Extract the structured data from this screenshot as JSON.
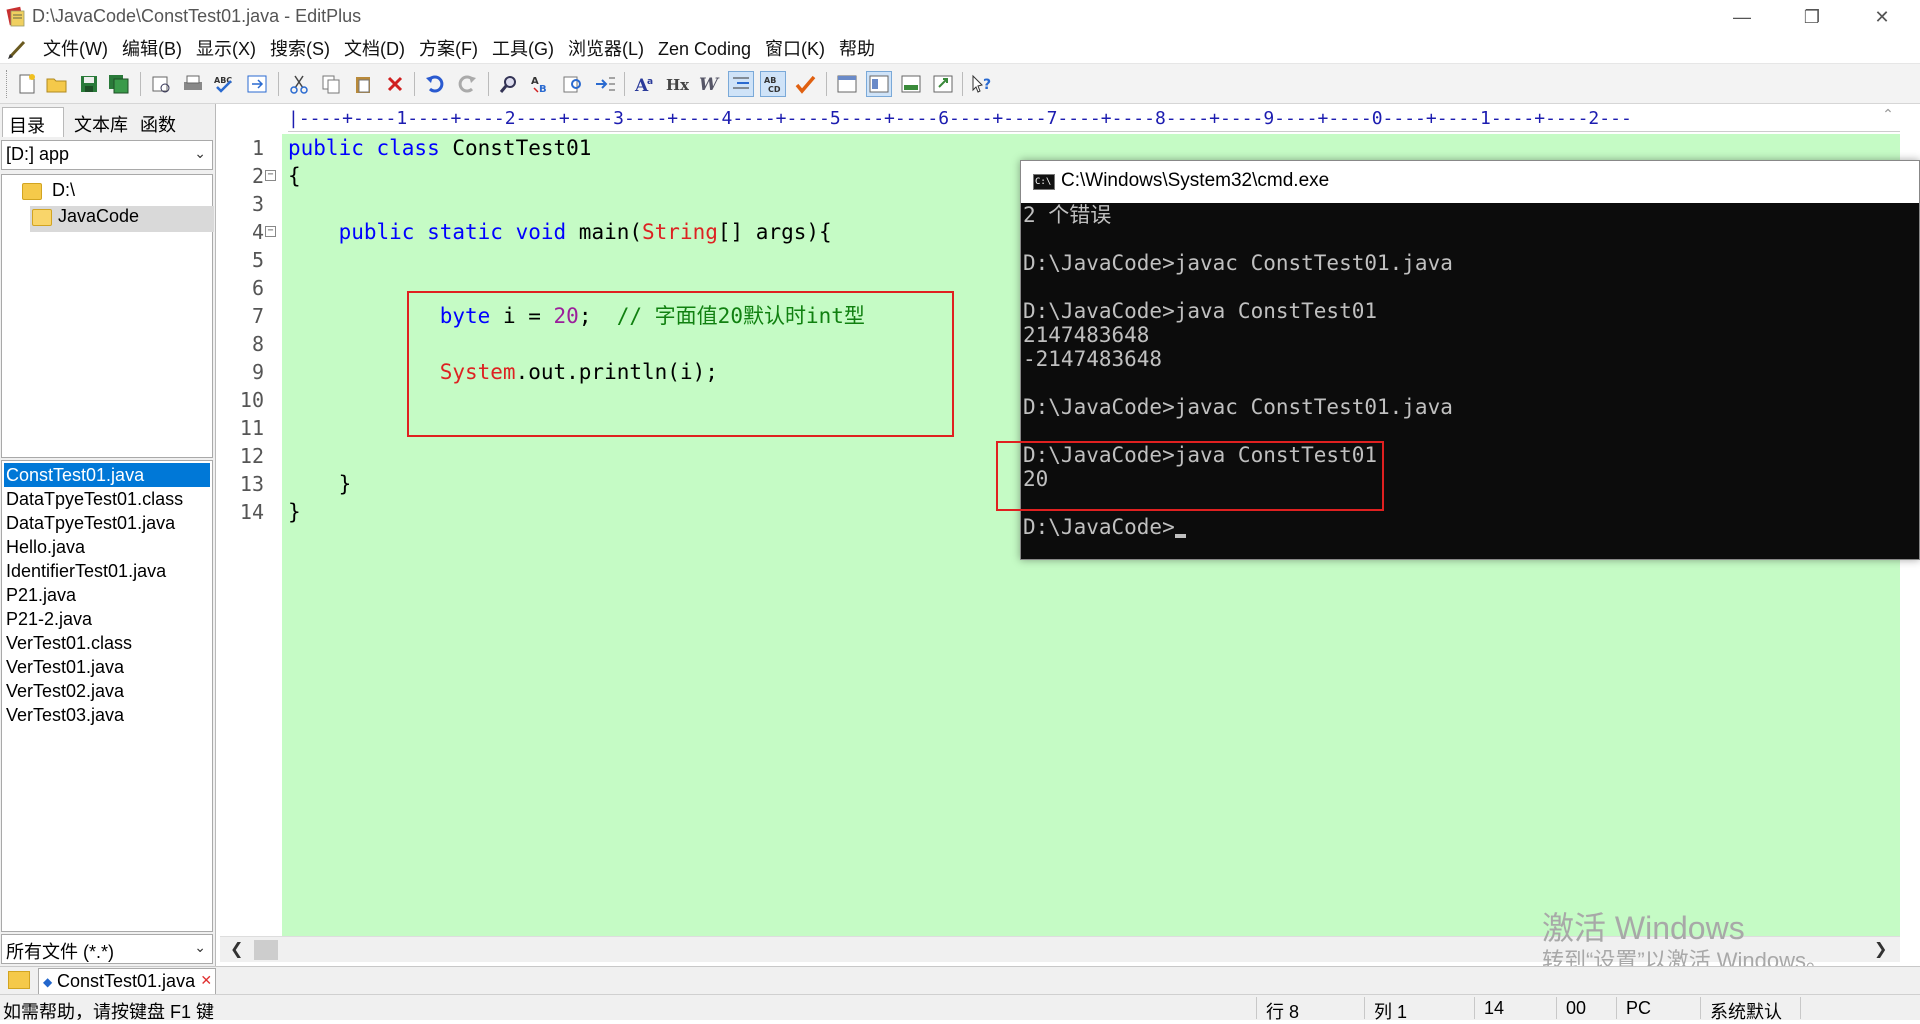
{
  "window": {
    "title": "D:\\JavaCode\\ConstTest01.java - EditPlus",
    "minimize": "—",
    "restore": "❐",
    "close": "✕"
  },
  "menu": [
    "文件(W)",
    "编辑(B)",
    "显示(X)",
    "搜索(S)",
    "文档(D)",
    "方案(F)",
    "工具(G)",
    "浏览器(L)",
    "Zen Coding",
    "窗口(K)",
    "帮助"
  ],
  "mdi_buttons": [
    "_",
    "▫",
    "x"
  ],
  "left_panel": {
    "tabs": [
      "目录",
      "文本库",
      "函数"
    ],
    "drive": "[D:] app",
    "tree": [
      "D:\\",
      "JavaCode"
    ],
    "files": [
      "ConstTest01.java",
      "DataTpyeTest01.class",
      "DataTpyeTest01.java",
      "Hello.java",
      "IdentifierTest01.java",
      "P21.java",
      "P21-2.java",
      "VerTest01.class",
      "VerTest01.java",
      "VerTest02.java",
      "VerTest03.java"
    ],
    "selected_file": "ConstTest01.java",
    "filter": "所有文件 (*.*)"
  },
  "editor": {
    "ruler": "|----+----1----+----2----+----3----+----4----+----5----+----6----+----7----+----8----+----9----+----0----+----1----+----2---",
    "line_numbers": [
      "1",
      "2",
      "3",
      "4",
      "5",
      "6",
      "7",
      "8",
      "9",
      "10",
      "11",
      "12",
      "13",
      "14"
    ],
    "code": {
      "l1_kw": "public class",
      "l1_name": " ConstTest01",
      "l2": "{",
      "l4_indent": "    ",
      "l4_kw": "public static void",
      "l4_mid": " main(",
      "l4_type": "String",
      "l4_rest": "[] args){",
      "l7_indent": "            ",
      "l7_kw": "byte",
      "l7_mid": " i = ",
      "l7_num": "20",
      "l7_semi": ";  ",
      "l7_comment": "// 字面值20默认时int型",
      "l9_indent": "            ",
      "l9_type": "System",
      "l9_rest": ".out.println(i);",
      "l12": "    }",
      "l13": "}"
    },
    "background": "#c5fbc5"
  },
  "cmd": {
    "title": "C:\\Windows\\System32\\cmd.exe",
    "icon_text": "C:\\",
    "lines": [
      "2 个错误",
      "",
      "D:\\JavaCode>javac ConstTest01.java",
      "",
      "D:\\JavaCode>java ConstTest01",
      "2147483648",
      "-2147483648",
      "",
      "D:\\JavaCode>javac ConstTest01.java",
      "",
      "D:\\JavaCode>java ConstTest01",
      "20",
      "",
      "D:\\JavaCode>"
    ]
  },
  "watermark": {
    "line1": "激活 Windows",
    "line2": "转到“设置”以激活 Windows。"
  },
  "doc_tab": {
    "label": "ConstTest01.java"
  },
  "status": {
    "help": "如需帮助，请按键盘 F1 键",
    "row": "行 8",
    "col": "列 1",
    "lines": "14",
    "code": "00",
    "eol": "PC",
    "encoding": "系统默认"
  },
  "colors": {
    "highlight_box": "#e02020",
    "selection": "#0078d7"
  }
}
